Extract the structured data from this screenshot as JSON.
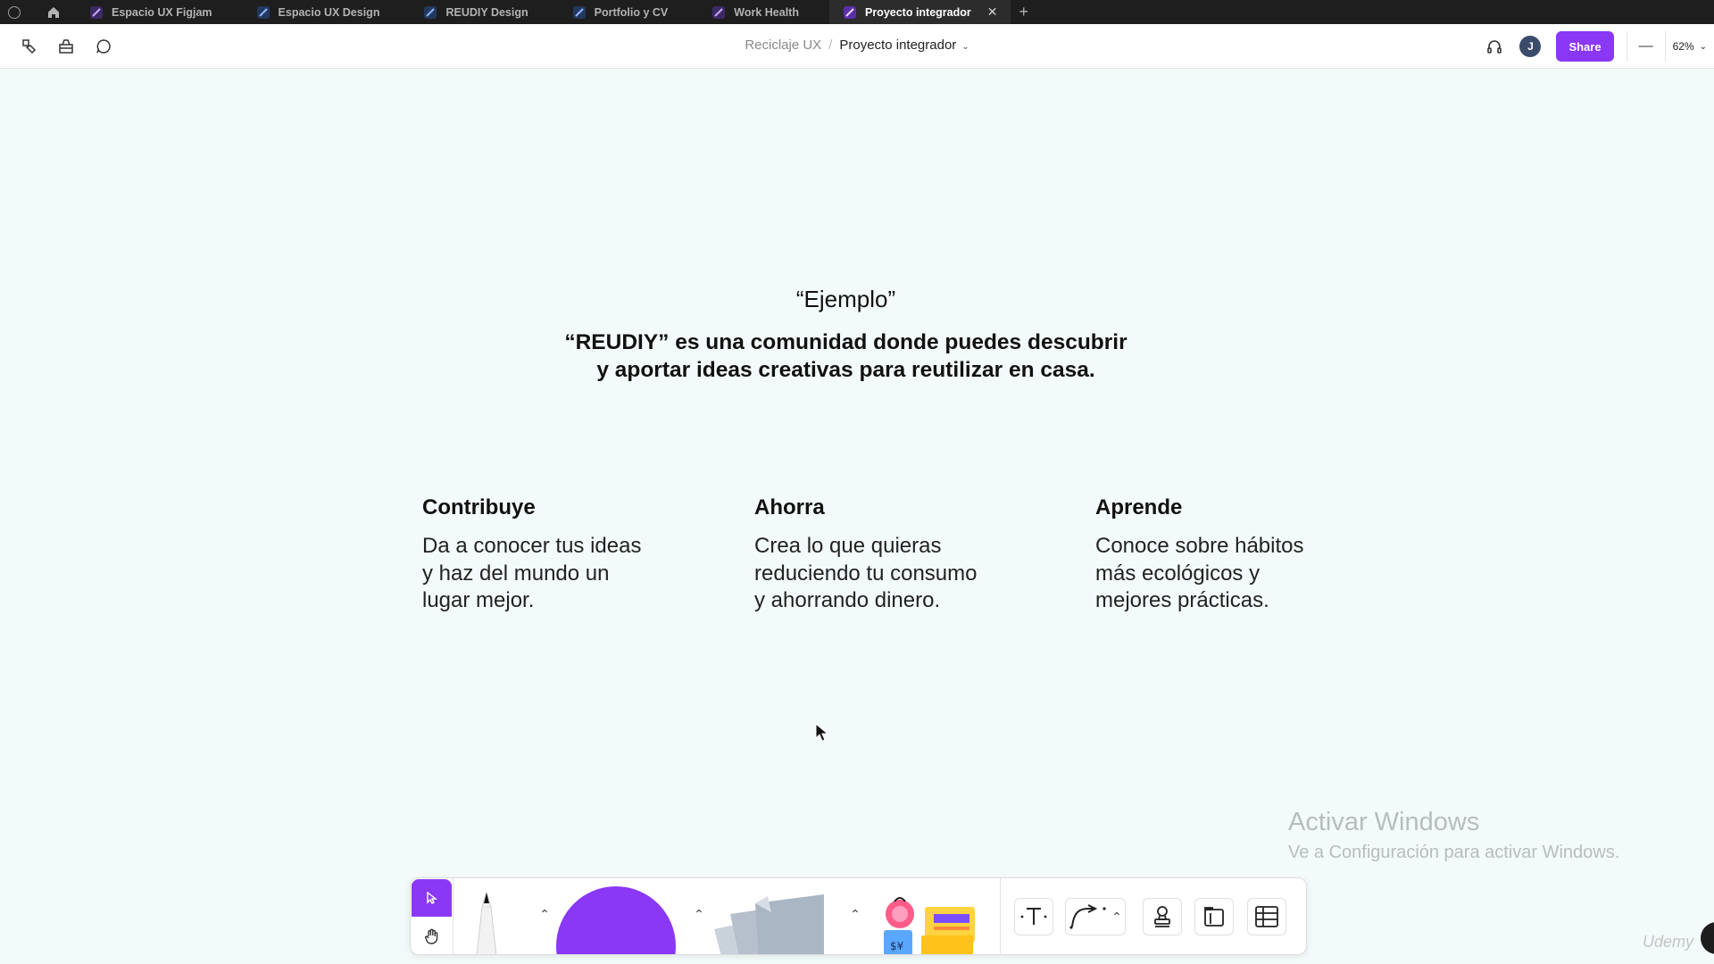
{
  "tabs": [
    {
      "label": "Espacio UX Figjam",
      "color": "#7c3aed"
    },
    {
      "label": "Espacio UX Design",
      "color": "#2563eb"
    },
    {
      "label": "REUDIY Design",
      "color": "#2563eb"
    },
    {
      "label": "Portfolio y CV",
      "color": "#2563eb"
    },
    {
      "label": "Work Health",
      "color": "#7c3aed"
    },
    {
      "label": "Proyecto integrador",
      "color": "#7c3aed",
      "active": true
    }
  ],
  "toolbar": {
    "breadcrumb_parent": "Reciclaje UX",
    "breadcrumb_separator": "/",
    "breadcrumb_current": "Proyecto integrador",
    "avatar_initial": "J",
    "share_label": "Share",
    "zoom_level": "62%",
    "minus_label": "—"
  },
  "canvas": {
    "example_label": "“Ejemplo”",
    "headline_line1": "“REUDIY” es una comunidad donde puedes descubrir",
    "headline_line2": "y aportar ideas creativas para reutilizar en casa.",
    "features": [
      {
        "title": "Contribuye",
        "line1": "Da a conocer tus ideas",
        "line2": "y haz del mundo un",
        "line3": "lugar mejor."
      },
      {
        "title": "Ahorra",
        "line1": "Crea lo que quieras",
        "line2": "reduciendo tu consumo",
        "line3": "y ahorrando dinero."
      },
      {
        "title": "Aprende",
        "line1": "Conoce sobre hábitos",
        "line2": "más ecológicos y",
        "line3": "mejores prácticas."
      }
    ]
  },
  "watermark": {
    "title": "Activar Windows",
    "subtitle": "Ve a Configuración para activar Windows.",
    "brand": "Udemy"
  },
  "colors": {
    "accent": "#8a38f5",
    "canvas_bg": "#f3fbfa",
    "tabbar_bg": "#1e1e1e"
  },
  "dock_tools": [
    "select-icon",
    "hand-icon",
    "marker-icon",
    "shape-icon",
    "sticky-note-icon",
    "stickers-icon",
    "text-icon",
    "connector-icon",
    "stamp-icon",
    "section-icon",
    "table-icon"
  ]
}
